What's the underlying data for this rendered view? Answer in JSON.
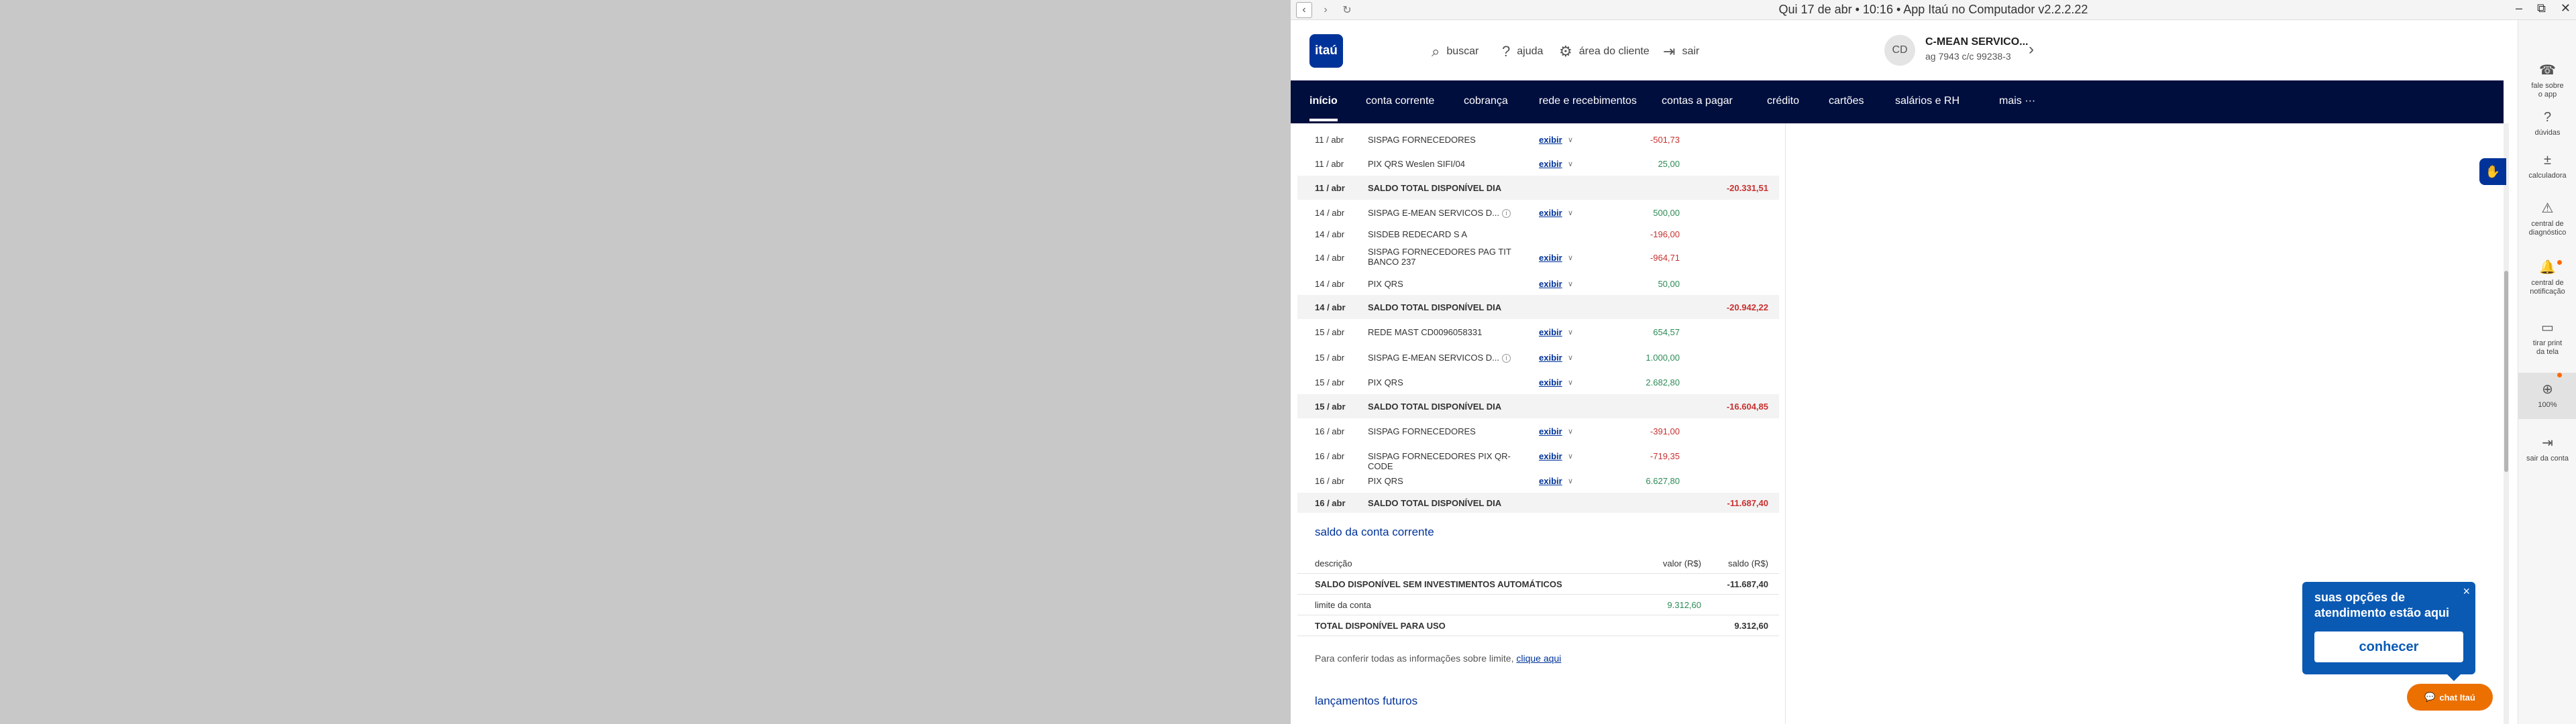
{
  "window": {
    "title": "Qui 17 de abr • 10:16 • App Itaú no Computador v2.2.2.22",
    "controls": [
      "–",
      "⧉",
      "✕"
    ]
  },
  "header": {
    "logo": "itaú",
    "search": "buscar",
    "help": "ajuda",
    "client_area": "área do cliente",
    "logout": "sair",
    "avatar": "CD",
    "account_name": "C-MEAN SERVICO...",
    "account_info": "ag 7943   c/c 99238-3"
  },
  "nav": {
    "items": [
      "início",
      "conta corrente",
      "cobrança",
      "rede e recebimentos",
      "contas a pagar",
      "crédito",
      "cartões",
      "salários e RH",
      "mais"
    ]
  },
  "statement": {
    "detail_label": "exibir",
    "rows": [
      {
        "date": "11 / abr",
        "desc": "SISPAG FORNECEDORES",
        "more": true,
        "value": "-501,73",
        "sign": "neg"
      },
      {
        "date": "11 / abr",
        "desc": "PIX QRS Weslen SIFI/04",
        "more": true,
        "value": "25,00",
        "sign": "pos"
      },
      {
        "date": "11 / abr",
        "desc": "SALDO TOTAL DISPONÍVEL DIA",
        "summary": true,
        "balance": "-20.331,51"
      },
      {
        "date": "14 / abr",
        "desc": "SISPAG E-MEAN SERVICOS D...",
        "info": true,
        "more": true,
        "value": "500,00",
        "sign": "pos"
      },
      {
        "date": "14 / abr",
        "desc": "SISDEB REDECARD S A",
        "value": "-196,00",
        "sign": "neg"
      },
      {
        "date": "14 / abr",
        "desc": "SISPAG FORNECEDORES PAG TIT BANCO 237",
        "more": true,
        "value": "-964,71",
        "sign": "neg",
        "tall": true
      },
      {
        "date": "14 / abr",
        "desc": "PIX QRS",
        "more": true,
        "value": "50,00",
        "sign": "pos"
      },
      {
        "date": "14 / abr",
        "desc": "SALDO TOTAL DISPONÍVEL DIA",
        "summary": true,
        "balance": "-20.942,22"
      },
      {
        "date": "15 / abr",
        "desc": "REDE MAST CD0096058331",
        "more": true,
        "value": "654,57",
        "sign": "pos"
      },
      {
        "date": "15 / abr",
        "desc": "SISPAG E-MEAN SERVICOS D...",
        "info": true,
        "more": true,
        "value": "1.000,00",
        "sign": "pos"
      },
      {
        "date": "15 / abr",
        "desc": "PIX QRS",
        "more": true,
        "value": "2.682,80",
        "sign": "pos"
      },
      {
        "date": "15 / abr",
        "desc": "SALDO TOTAL DISPONÍVEL DIA",
        "summary": true,
        "balance": "-16.604,85"
      },
      {
        "date": "16 / abr",
        "desc": "SISPAG FORNECEDORES",
        "more": true,
        "value": "-391,00",
        "sign": "neg"
      },
      {
        "date": "16 / abr",
        "desc": "SISPAG FORNECEDORES PIX QR-CODE",
        "more": true,
        "value": "-719,35",
        "sign": "neg"
      },
      {
        "date": "16 / abr",
        "desc": "PIX QRS",
        "more": true,
        "value": "6.627,80",
        "sign": "pos"
      },
      {
        "date": "16 / abr",
        "desc": "SALDO TOTAL DISPONÍVEL DIA",
        "summary": true,
        "balance": "-11.687,40"
      }
    ]
  },
  "balance_section": {
    "title": "saldo da conta corrente",
    "col_desc": "descrição",
    "col_value": "valor (R$)",
    "col_balance": "saldo (R$)",
    "rows": [
      {
        "desc": "SALDO DISPONÍVEL SEM INVESTIMENTOS AUTOMÁTICOS",
        "value": "",
        "balance": "-11.687,40",
        "bold": true
      },
      {
        "desc": "limite da conta",
        "value": "9.312,60",
        "balance": "",
        "bold": false
      },
      {
        "desc": "TOTAL DISPONÍVEL PARA USO",
        "value": "",
        "balance": "9.312,60",
        "bold": true
      }
    ],
    "limit_note": "Para conferir todas as informações sobre limite,",
    "limit_link": "clique aqui"
  },
  "future_section": {
    "title": "lançamentos futuros"
  },
  "tools": [
    {
      "icon": "☎",
      "label1": "fale sobre",
      "label2": "o app"
    },
    {
      "icon": "?",
      "label1": "dúvidas",
      "label2": ""
    },
    {
      "icon": "±",
      "label1": "calculadora",
      "label2": ""
    },
    {
      "icon": "⚠",
      "label1": "central de",
      "label2": "diagnóstico"
    },
    {
      "icon": "🔔",
      "label1": "central de",
      "label2": "notificação"
    },
    {
      "icon": "▭",
      "label1": "tirar print",
      "label2": "da tela"
    },
    {
      "icon": "⊕",
      "label1": "100%",
      "label2": ""
    },
    {
      "icon": "⇥",
      "label1": "sair da conta",
      "label2": ""
    }
  ],
  "popup": {
    "text": "suas opções de atendimento estão aqui",
    "button": "conhecer",
    "close": "×"
  },
  "chat": {
    "label": "chat Itaú"
  },
  "colors": {
    "nav_bg": "#000e3e",
    "brand": "#003399",
    "negative": "#c83030",
    "positive": "#2e8b57",
    "chat": "#ec7000",
    "popup": "#0a5ab4"
  }
}
